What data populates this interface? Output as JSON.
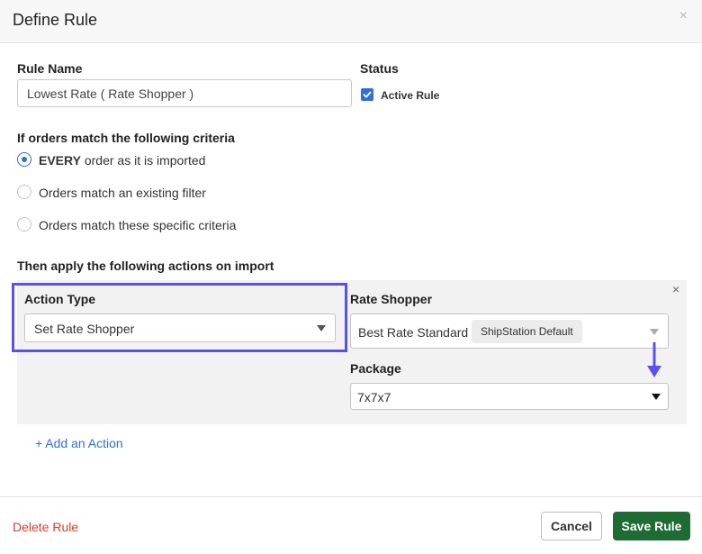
{
  "dialog": {
    "title": "Define Rule",
    "close_glyph": "×"
  },
  "rule_name": {
    "label": "Rule Name",
    "value": "Lowest Rate ( Rate Shopper )"
  },
  "status": {
    "label": "Status",
    "checkbox_label": "Active Rule",
    "checked": true
  },
  "criteria": {
    "heading": "If orders match the following criteria",
    "options": [
      {
        "bold": "EVERY",
        "rest": " order as it is imported",
        "selected": true
      },
      {
        "text": "Orders match an existing filter",
        "selected": false
      },
      {
        "text": "Orders match these specific criteria",
        "selected": false
      }
    ]
  },
  "actions": {
    "heading": "Then apply the following actions on import",
    "remove_glyph": "×",
    "action_type": {
      "label": "Action Type",
      "value": "Set Rate Shopper"
    },
    "rate_shopper": {
      "label": "Rate Shopper",
      "value": "Best Rate Standard",
      "badge": "ShipStation Default"
    },
    "package": {
      "label": "Package",
      "value": "7x7x7"
    },
    "add_action": "+ Add an Action"
  },
  "footer": {
    "delete_label": "Delete Rule",
    "cancel_label": "Cancel",
    "save_label": "Save Rule"
  },
  "colors": {
    "accent_blue": "#2f6fd6",
    "highlight_purple": "#5a4ff0",
    "save_green": "#1e6b33",
    "delete_red": "#d23f26"
  },
  "icons": {
    "close": "close-icon",
    "check": "checkmark-icon",
    "caret": "caret-down-icon",
    "arrow": "arrow-down-icon"
  }
}
